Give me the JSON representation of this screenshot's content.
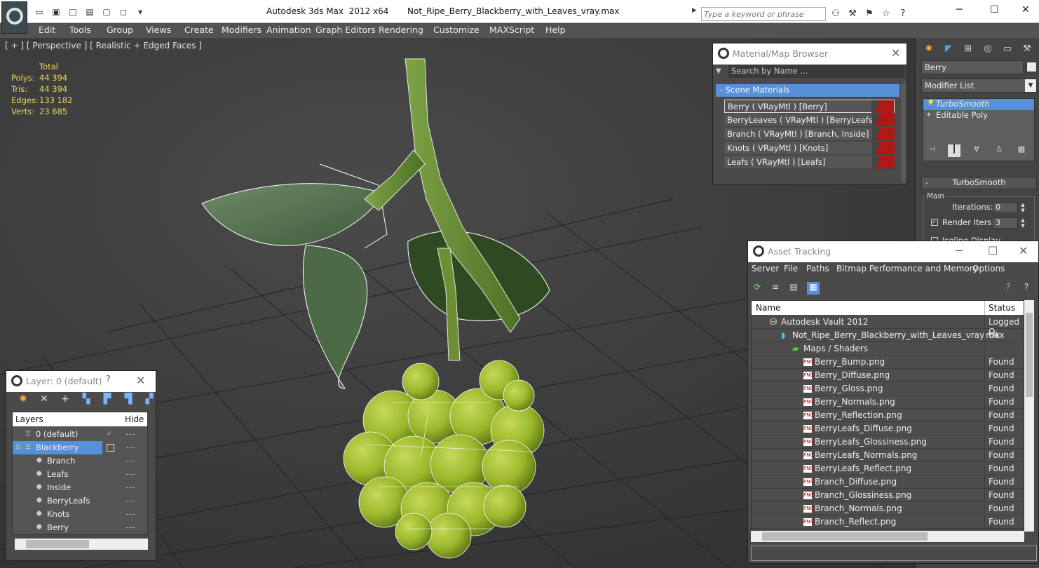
{
  "titlebar": {
    "title": "Autodesk 3ds Max  2012 x64       Not_Ripe_Berry_Blackberry_with_Leaves_vray.max",
    "search_placeholder": "Type a keyword or phrase"
  },
  "menu": [
    "Edit",
    "Tools",
    "Group",
    "Views",
    "Create",
    "Modifiers",
    "Animation",
    "Graph Editors",
    "Rendering",
    "Customize",
    "MAXScript",
    "Help"
  ],
  "viewport": {
    "label": "[ + ] [ Perspective ] [ Realistic + Edged Faces ]",
    "stats": {
      "header": "Total",
      "rows": [
        {
          "k": "Polys:",
          "v": "44 394"
        },
        {
          "k": "Tris:",
          "v": "44 394"
        },
        {
          "k": "Edges:",
          "v": "133 182"
        },
        {
          "k": "Verts:",
          "v": "23 685"
        }
      ]
    }
  },
  "command_panel": {
    "object_name": "Berry",
    "modifier_list": "Modifier List",
    "stack": [
      "TurboSmooth",
      "Editable Poly"
    ],
    "rollout": "TurboSmooth",
    "group": "Main",
    "iterations_label": "Iterations:",
    "iterations_value": "0",
    "render_iters_label": "Render Iters:",
    "render_iters_value": "3",
    "isoline": "Isoline Display"
  },
  "material_browser": {
    "title": "Material/Map Browser",
    "search_placeholder": "Search by Name ...",
    "section": "Scene Materials",
    "materials": [
      "Berry  ( VRayMtl ) [Berry]",
      "BerryLeaves  ( VRayMtl ) [BerryLeafs]",
      "Branch  ( VRayMtl ) [Branch, Inside]",
      "Knots  ( VRayMtl ) [Knots]",
      "Leafs  ( VRayMtl ) [Leafs]"
    ]
  },
  "asset_tracking": {
    "title": "Asset Tracking",
    "menu": [
      "Server",
      "File",
      "Paths",
      "Bitmap Performance and Memory",
      "Options"
    ],
    "col_name": "Name",
    "col_status": "Status",
    "vault": {
      "name": "Autodesk Vault 2012",
      "status": "Logged O"
    },
    "file": {
      "name": "Not_Ripe_Berry_Blackberry_with_Leaves_vray.max",
      "status": "Ok"
    },
    "group": "Maps / Shaders",
    "maps": [
      {
        "name": "Berry_Bump.png",
        "status": "Found"
      },
      {
        "name": "Berry_Diffuse.png",
        "status": "Found"
      },
      {
        "name": "Berry_Gloss.png",
        "status": "Found"
      },
      {
        "name": "Berry_Normals.png",
        "status": "Found"
      },
      {
        "name": "Berry_Reflection.png",
        "status": "Found"
      },
      {
        "name": "BerryLeafs_Diffuse.png",
        "status": "Found"
      },
      {
        "name": "BerryLeafs_Glossiness.png",
        "status": "Found"
      },
      {
        "name": "BerryLeafs_Normals.png",
        "status": "Found"
      },
      {
        "name": "BerryLeafs_Reflect.png",
        "status": "Found"
      },
      {
        "name": "Branch_Diffuse.png",
        "status": "Found"
      },
      {
        "name": "Branch_Glossiness.png",
        "status": "Found"
      },
      {
        "name": "Branch_Normals.png",
        "status": "Found"
      },
      {
        "name": "Branch_Reflect.png",
        "status": "Found"
      }
    ],
    "png_badge": "PNG"
  },
  "layers": {
    "title": "Layer: 0 (default)",
    "help": "?",
    "col_layers": "Layers",
    "col_hide": "Hide",
    "items": [
      {
        "name": "0 (default)"
      },
      {
        "name": "Blackberry"
      },
      {
        "name": "Branch"
      },
      {
        "name": "Leafs"
      },
      {
        "name": "Inside"
      },
      {
        "name": "BerryLeafs"
      },
      {
        "name": "Knots"
      },
      {
        "name": "Berry"
      }
    ]
  }
}
